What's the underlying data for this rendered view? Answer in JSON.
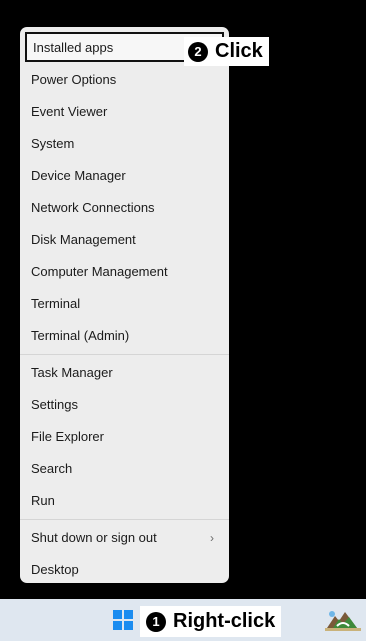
{
  "menu": {
    "groups": [
      {
        "items": [
          {
            "label": "Installed apps"
          },
          {
            "label": "Power Options"
          },
          {
            "label": "Event Viewer"
          },
          {
            "label": "System"
          },
          {
            "label": "Device Manager"
          },
          {
            "label": "Network Connections"
          },
          {
            "label": "Disk Management"
          },
          {
            "label": "Computer Management"
          },
          {
            "label": "Terminal"
          },
          {
            "label": "Terminal (Admin)"
          }
        ]
      },
      {
        "items": [
          {
            "label": "Task Manager"
          },
          {
            "label": "Settings"
          },
          {
            "label": "File Explorer"
          },
          {
            "label": "Search"
          },
          {
            "label": "Run"
          }
        ]
      },
      {
        "items": [
          {
            "label": "Shut down or sign out",
            "submenu_glyph": "›"
          },
          {
            "label": "Desktop"
          }
        ]
      }
    ]
  },
  "callouts": {
    "click": {
      "number": "2",
      "text": "Click"
    },
    "right_click": {
      "number": "1",
      "text": "Right-click"
    }
  },
  "taskbar": {
    "start_icon": "windows-start-icon",
    "tray_icon": "weather-icon",
    "accent_color": "#1a8cf0"
  }
}
